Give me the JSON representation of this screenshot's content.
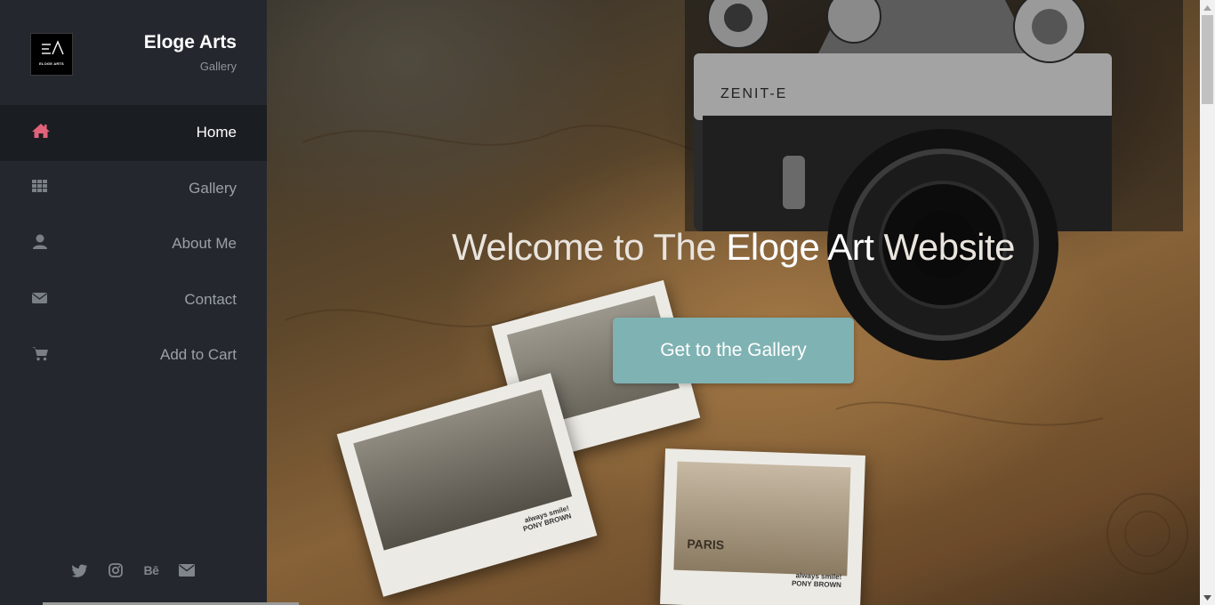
{
  "brand": {
    "logo_text": "ELOGE ARTS",
    "title": "Eloge Arts",
    "subtitle": "Gallery"
  },
  "nav": {
    "items": [
      {
        "label": "Home",
        "icon": "home-icon",
        "active": true
      },
      {
        "label": "Gallery",
        "icon": "grid-icon",
        "active": false
      },
      {
        "label": "About Me",
        "icon": "user-icon",
        "active": false
      },
      {
        "label": "Contact",
        "icon": "envelope-icon",
        "active": false
      },
      {
        "label": "Add to Cart",
        "icon": "cart-icon",
        "active": false
      }
    ]
  },
  "social": [
    "twitter-icon",
    "instagram-icon",
    "behance-icon",
    "envelope-icon"
  ],
  "social_behance_text": "Bē",
  "hero": {
    "title_part1": "Welcome to The ",
    "title_strong": "Eloge Art",
    "title_part2": " Website",
    "cta_label": "Get to the Gallery",
    "camera_brand": "ZENIT-E",
    "photo_caption_1": "always smile!",
    "photo_caption_2": "PONY BROWN",
    "photo_paris": "PARIS",
    "photo_caption_3": "always smile!",
    "photo_caption_4": "PONY BROWN"
  },
  "colors": {
    "sidebar_bg": "#24282e",
    "active_bg": "#1a1d21",
    "accent_home": "#e0637a",
    "cta_bg": "#7fb2b3"
  }
}
